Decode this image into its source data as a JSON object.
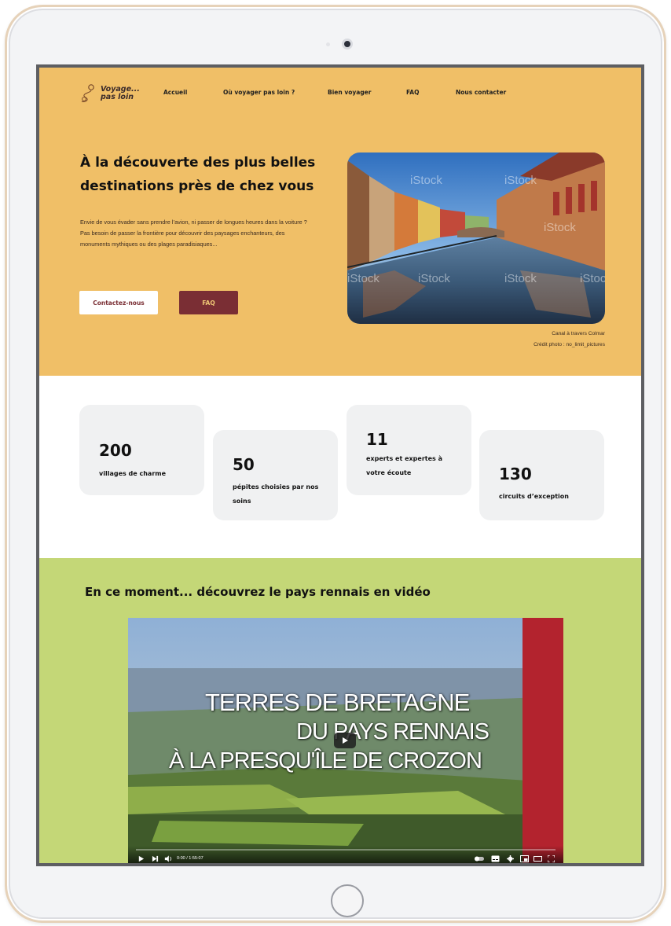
{
  "logo": {
    "line1": "Voyage...",
    "line2": "pas loin"
  },
  "nav": {
    "items": [
      "Accueil",
      "Où voyager pas loin ?",
      "Bien voyager",
      "FAQ",
      "Nous contacter"
    ]
  },
  "hero": {
    "title": "À la découverte des plus belles destinations près de chez vous",
    "text": "Envie de vous évader sans prendre l’avion, ni passer de longues heures dans la voiture ? Pas besoin de passer la frontière pour découvrir des paysages enchanteurs, des monuments mythiques ou des plages paradisiaques...",
    "btn_contact": "Contactez-nous",
    "btn_faq": "FAQ",
    "caption1": "Canal à travers Colmar",
    "caption2": "Crédit photo : no_limit_pictures",
    "watermark": "iStock"
  },
  "stats": [
    {
      "num": "200",
      "label": "villages de charme"
    },
    {
      "num": "50",
      "label": "pépites choisies par nos soins"
    },
    {
      "num": "11",
      "label": "experts et expertes à votre écoute"
    },
    {
      "num": "130",
      "label": "circuits d’exception"
    }
  ],
  "video": {
    "section_title": "En ce moment... découvrez le pays rennais en vidéo",
    "line1": "TERRES DE BRETAGNE",
    "line2": "DU PAYS RENNAIS",
    "line3": "À LA PRESQU'ÎLE DE CROZON",
    "time": "0:00 / 1:55:07",
    "progress": 0
  },
  "colors": {
    "hero_bg": "#f0bf67",
    "accent": "#7a2e34",
    "video_bg": "#c4d777",
    "stat_bg": "#f0f1f2"
  }
}
